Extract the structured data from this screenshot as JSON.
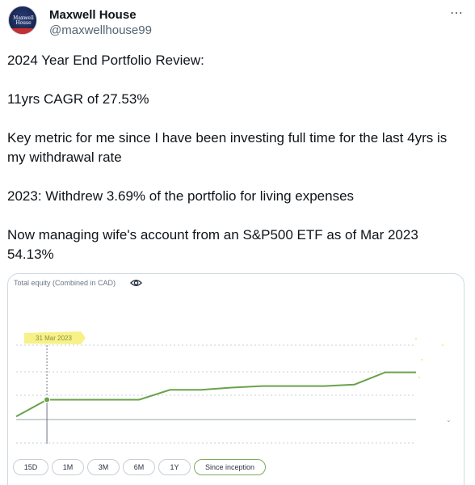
{
  "author": {
    "display_name": "Maxwell House",
    "handle": "@maxwellhouse99",
    "avatar_text": "Maxwell House",
    "more_icon": "more-horizontal-icon"
  },
  "tweet": {
    "lines": [
      "2024 Year End Portfolio Review:",
      "11yrs CAGR of 27.53%",
      "Key metric for me since I have been investing full time for the last 4yrs is my withdrawal rate",
      "2023: Withdrew 3.69% of the portfolio for living expenses",
      "Now managing wife's account from an S&P500 ETF as of Mar 2023 54.13%"
    ]
  },
  "card": {
    "title": "Total equity (Combined in CAD)",
    "eye_icon": "eye-icon",
    "highlight_label": "31 Mar 2023",
    "range_buttons": [
      "15D",
      "1M",
      "3M",
      "6M",
      "1Y",
      "Since inception"
    ],
    "active_range": "Since inception",
    "line_color": "#6aa24a",
    "highlight_color": "#f6f07a"
  },
  "chart_data": {
    "type": "line",
    "title": "Total equity (Combined in CAD)",
    "xlabel": "",
    "ylabel": "",
    "grid": true,
    "highlight_x": "31 Mar 2023",
    "series": [
      {
        "values": [
          0.0,
          0.22,
          0.22,
          0.22,
          0.22,
          0.35,
          0.35,
          0.38,
          0.4,
          0.4,
          0.4,
          0.42,
          0.58,
          0.58
        ]
      }
    ],
    "ylim": [
      -0.05,
      1.0
    ]
  }
}
